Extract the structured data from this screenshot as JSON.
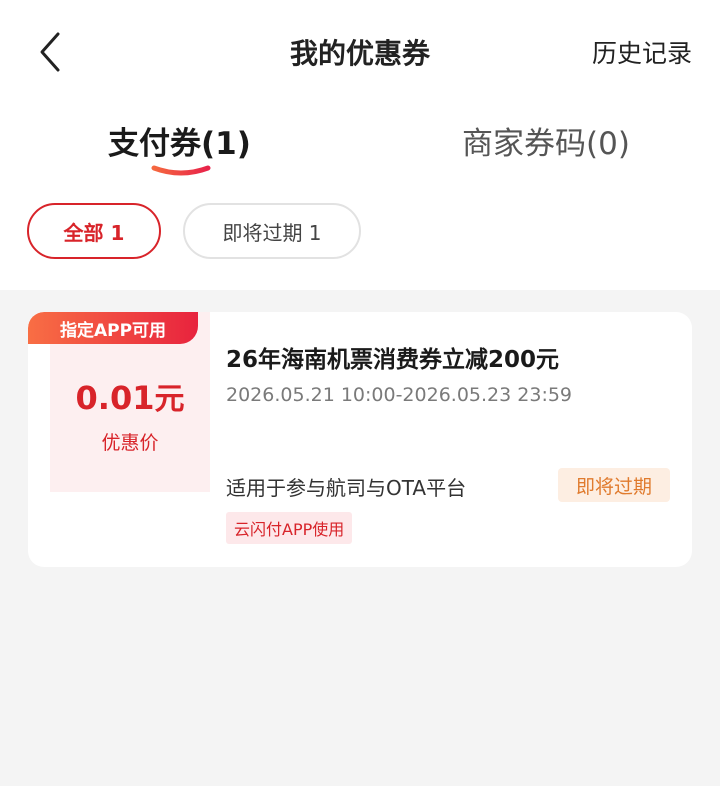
{
  "header": {
    "title": "我的优惠券",
    "history_label": "历史记录"
  },
  "tabs": [
    {
      "label": "支付券(1)",
      "active": true
    },
    {
      "label": "商家券码(0)",
      "active": false
    }
  ],
  "filters": [
    {
      "label": "全部 1",
      "active": true
    },
    {
      "label": "即将过期 1",
      "active": false
    }
  ],
  "coupon": {
    "corner_tag": "指定APP可用",
    "price_value": "0.01",
    "price_unit": "元",
    "price_label": "优惠价",
    "title": "26年海南机票消费券立减200元",
    "validity": "2026.05.21 10:00-2026.05.23 23:59",
    "description": "适用于参与航司与OTA平台",
    "status_badge": "即将过期",
    "app_tag": "云闪付APP使用"
  },
  "colors": {
    "accent_red": "#d8242a",
    "expire_orange": "#e07b2e",
    "background_gray": "#f4f4f4"
  },
  "icons": {
    "back": "chevron-left-icon"
  }
}
